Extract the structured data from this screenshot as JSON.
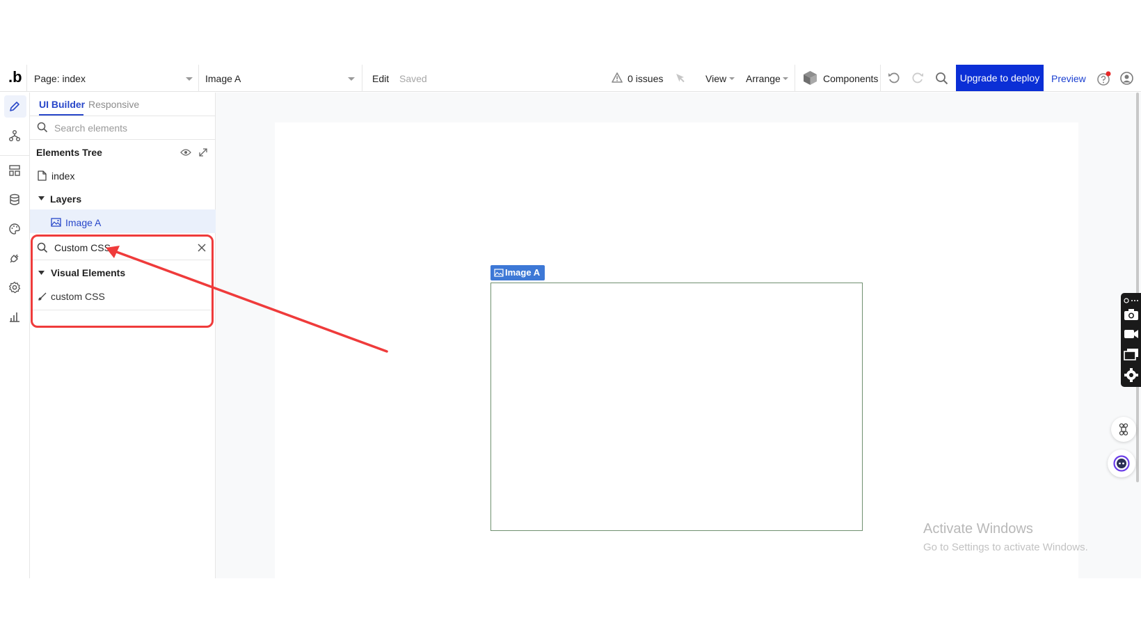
{
  "app": {
    "logo": ".b"
  },
  "topbar": {
    "page_selector": "Page: index",
    "element_selector": "Image A",
    "edit_label": "Edit",
    "saved_label": "Saved",
    "issues_label": "0 issues",
    "view_label": "View",
    "arrange_label": "Arrange",
    "components_label": "Components",
    "upgrade_label": "Upgrade to deploy",
    "preview_label": "Preview"
  },
  "panel": {
    "tab_active": "UI Builder",
    "tab_inactive": "Responsive",
    "search_placeholder": "Search elements",
    "tree_title": "Elements Tree",
    "page_item": "index",
    "layers_label": "Layers",
    "layer_item": "Image A",
    "search_value": "Custom CSS",
    "group_label": "Visual Elements",
    "result_item": "custom CSS"
  },
  "canvas": {
    "element_tag": "Image A"
  },
  "watermark": {
    "line1": "Activate Windows",
    "line2": "Go to Settings to activate Windows."
  },
  "colors": {
    "accent": "#0b2fd6",
    "link": "#1a3fd0",
    "annotation": "#ef3b3b",
    "element_tag": "#3d78d6"
  }
}
